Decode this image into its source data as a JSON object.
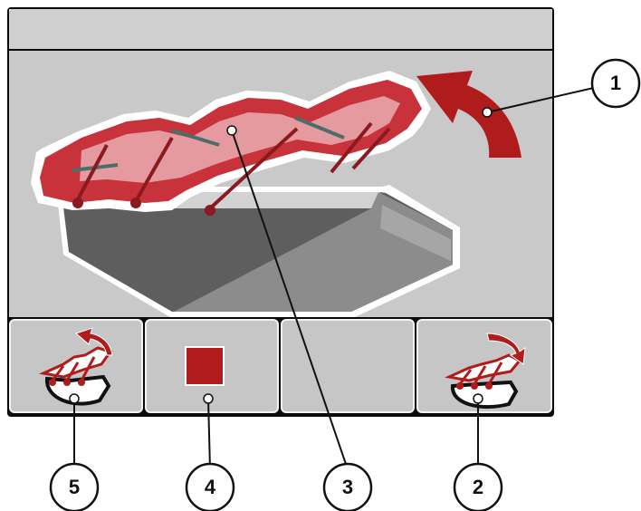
{
  "screen": {
    "title": "",
    "action": {
      "icon": "cover-rotate-open-arrow-icon",
      "color": "#b01c1c"
    },
    "illustration": {
      "icon": "hopper-cover-icon",
      "cover_color": "#c8323a",
      "hopper_color": "#5e5e5e"
    }
  },
  "softkeys": [
    {
      "name": "softkey-open-cover",
      "icon": "open-cover-icon"
    },
    {
      "name": "softkey-stop",
      "icon": "stop-square-icon"
    },
    {
      "name": "softkey-empty",
      "icon": ""
    },
    {
      "name": "softkey-close-cover",
      "icon": "close-cover-icon"
    }
  ],
  "callouts": [
    "1",
    "2",
    "3",
    "4",
    "5"
  ]
}
